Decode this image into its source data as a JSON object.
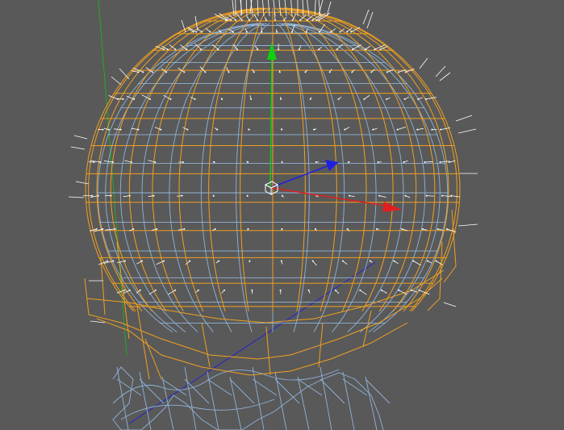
{
  "viewport": {
    "background_color": "#595959",
    "mesh_colors": {
      "head_wireframe": "#8fb3d9",
      "helmet_wireframe": "#f0a020",
      "normals": "#ffffff"
    },
    "gizmo": {
      "x_axis_color": "#e02020",
      "y_axis_color": "#10d010",
      "z_axis_color": "#2020e0",
      "world_y_line_color": "#22aa22",
      "pivot_icon": "pivot-cube-icon"
    }
  }
}
